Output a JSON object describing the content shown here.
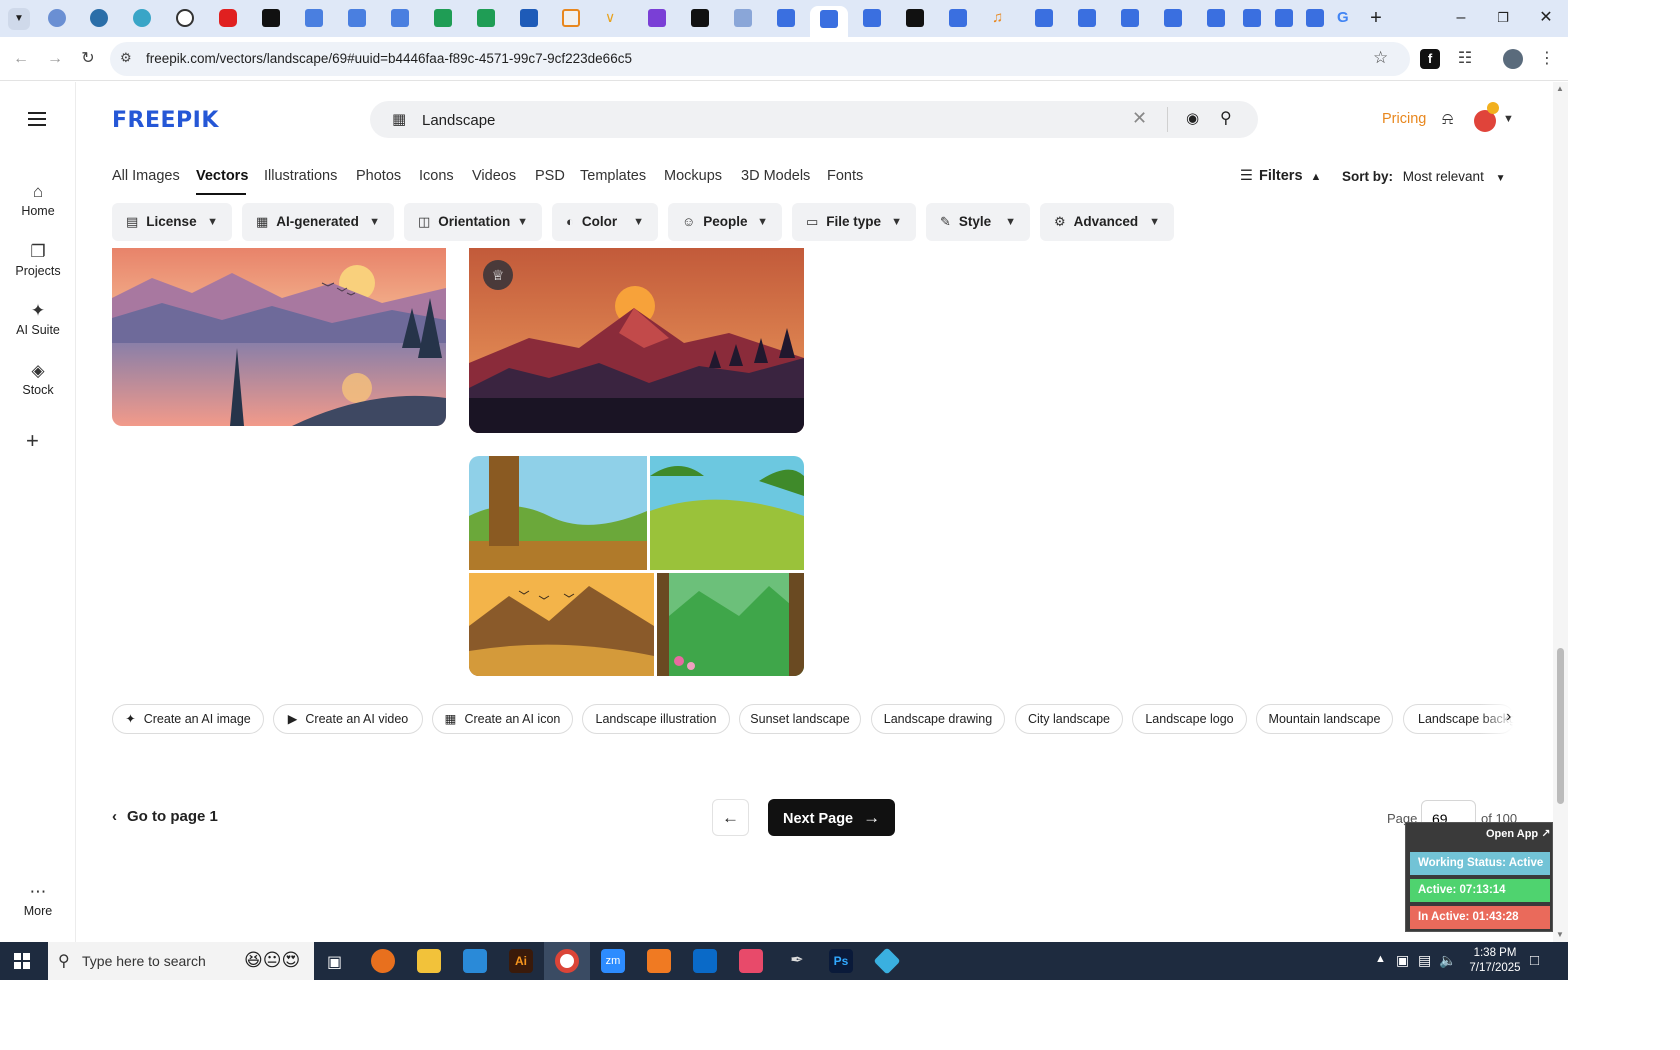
{
  "browser": {
    "url": "freepik.com/vectors/landscape/69#uuid=b4446faa-f89c-4571-99c7-9cf223de66c5"
  },
  "site": {
    "logo": "FREEPIK",
    "search_value": "Landscape",
    "pricing": "Pricing"
  },
  "rail": {
    "home": "Home",
    "projects": "Projects",
    "ai_suite": "AI Suite",
    "stock": "Stock",
    "more": "More"
  },
  "categories": [
    "All Images",
    "Vectors",
    "Illustrations",
    "Photos",
    "Icons",
    "Videos",
    "PSD",
    "Templates",
    "Mockups",
    "3D Models",
    "Fonts"
  ],
  "active_category": "Vectors",
  "filters_label": "Filters",
  "sort": {
    "label": "Sort by:",
    "value": "Most relevant"
  },
  "filter_chips": [
    "License",
    "AI-generated",
    "Orientation",
    "Color",
    "People",
    "File type",
    "Style",
    "Advanced"
  ],
  "suggestions": [
    "Create an AI image",
    "Create an AI video",
    "Create an AI icon",
    "Landscape illustration",
    "Sunset landscape",
    "Landscape drawing",
    "City landscape",
    "Landscape logo",
    "Mountain landscape",
    "Landscape background"
  ],
  "pagination": {
    "goto_first": "Go to page 1",
    "next": "Next Page",
    "page_label": "Page",
    "current_page": "69",
    "of_total": "of 100"
  },
  "tracker": {
    "open_app": "Open App ↗",
    "status": "Working Status: Active",
    "active": "Active: 07:13:14",
    "inactive": "In Active: 01:43:28",
    "colors": {
      "status": "#72c3d6",
      "active": "#4fd36f",
      "inactive": "#ea6a5b"
    }
  },
  "taskbar": {
    "search_placeholder": "Type here to search",
    "time": "1:38 PM",
    "date": "7/17/2025"
  },
  "colors": {
    "brand": "#2557d6",
    "pricing": "#e8871e",
    "tab_strip": "#dfe8f7",
    "taskbar": "#1e2b3f"
  }
}
